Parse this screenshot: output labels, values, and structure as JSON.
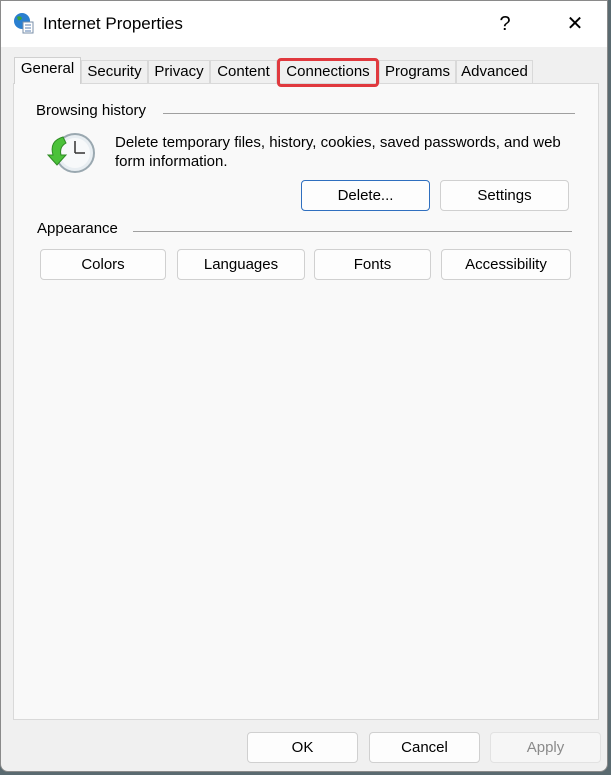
{
  "window": {
    "title": "Internet Properties",
    "help_label": "?",
    "close_label": "✕"
  },
  "tabs": [
    {
      "label": "General",
      "selected": true
    },
    {
      "label": "Security"
    },
    {
      "label": "Privacy"
    },
    {
      "label": "Content"
    },
    {
      "label": "Connections",
      "highlighted": true
    },
    {
      "label": "Programs"
    },
    {
      "label": "Advanced"
    }
  ],
  "browsing_history": {
    "heading": "Browsing history",
    "description": "Delete temporary files, history, cookies, saved passwords, and web form information.",
    "delete_label": "Delete...",
    "settings_label": "Settings"
  },
  "appearance": {
    "heading": "Appearance",
    "buttons": [
      "Colors",
      "Languages",
      "Fonts",
      "Accessibility"
    ]
  },
  "footer": {
    "ok": "OK",
    "cancel": "Cancel",
    "apply": "Apply"
  },
  "colors": {
    "highlight": "#e0393e",
    "default_button_border": "#2f6fbf"
  }
}
